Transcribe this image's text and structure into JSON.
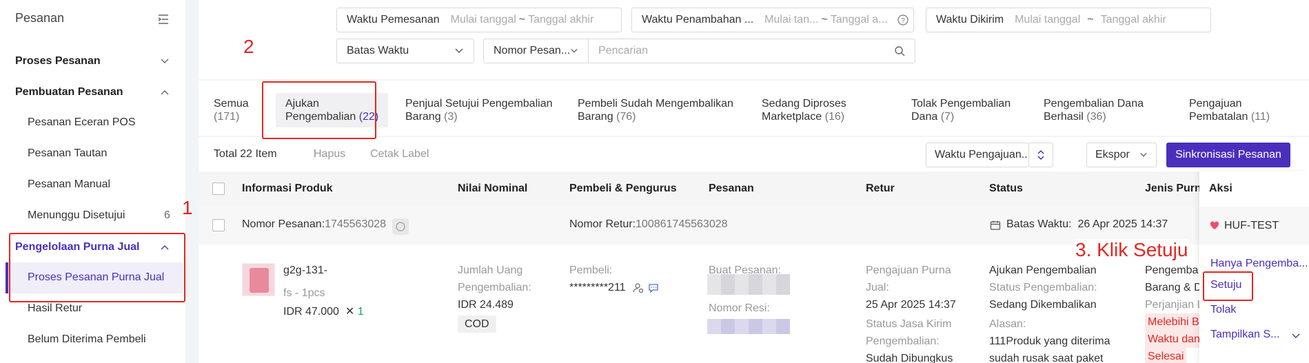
{
  "sidebar": {
    "title": "Pesanan",
    "groups": [
      {
        "label": "Proses Pesanan"
      },
      {
        "label": "Pembuatan Pesanan"
      },
      {
        "label": "Pengelolaan Purna Jual"
      }
    ],
    "items": [
      {
        "label": "Pesanan Eceran POS"
      },
      {
        "label": "Pesanan Tautan"
      },
      {
        "label": "Pesanan Manual"
      },
      {
        "label": "Menunggu Disetujui",
        "count": "6"
      },
      {
        "label": "Proses Pesanan Purna Jual"
      },
      {
        "label": "Hasil Retur"
      },
      {
        "label": "Belum Diterima Pembeli"
      }
    ]
  },
  "annotations": {
    "step1": "1",
    "step2": "2",
    "step3": "3. Klik Setuju"
  },
  "filters": {
    "order_time": {
      "label": "Waktu Pemesanan",
      "start": "Mulai tanggal",
      "sep": "~",
      "end": "Tanggal akhir"
    },
    "added_time": {
      "label": "Waktu Penambahan ...",
      "start": "Mulai tan...",
      "sep": "~",
      "end": "Tanggal a..."
    },
    "sent_time": {
      "label": "Waktu Dikirim",
      "start": "Mulai tanggal",
      "sep": "~",
      "end": "Tanggal akhir"
    },
    "deadline": {
      "label": "Batas Waktu"
    },
    "order_no": {
      "label": "Nomor Pesan..."
    },
    "search": {
      "placeholder": "Pencarian"
    }
  },
  "tabs": [
    {
      "line1": "Semua",
      "count": "(171)"
    },
    {
      "line1": "Ajukan",
      "line2": "Pengembalian",
      "count": "(22)"
    },
    {
      "line1": "Penjual Setujui Pengembalian",
      "line2": "Barang",
      "count": "(3)"
    },
    {
      "line1": "Pembeli Sudah Mengembalikan",
      "line2": "Barang",
      "count": "(76)"
    },
    {
      "line1": "Sedang Diproses",
      "line2": "Marketplace",
      "count": "(16)"
    },
    {
      "line1": "Tolak Pengembalian",
      "line2": "Dana",
      "count": "(7)"
    },
    {
      "line1": "Pengembalian Dana",
      "line2": "Berhasil",
      "count": "(36)"
    },
    {
      "line1": "Pengajuan",
      "line2": "Pembatalan",
      "count": "(11)"
    }
  ],
  "toolbar": {
    "total": "Total 22 Item",
    "delete": "Hapus",
    "print": "Cetak Label",
    "sort_select": "Waktu Pengajuan...",
    "export": "Ekspor",
    "sync": "Sinkronisasi Pesanan"
  },
  "table": {
    "headers": [
      "Informasi Produk",
      "Nilai Nominal",
      "Pembeli & Pengurus",
      "Pesanan",
      "Retur",
      "Status",
      "Jenis Purna",
      "Aksi"
    ]
  },
  "order": {
    "order_no_label": "Nomor Pesanan:",
    "order_no": "1745563028",
    "return_no_label": "Nomor Retur:",
    "return_no": "100861745563028",
    "deadline_label": "Batas Waktu:",
    "deadline": "26 Apr 2025 14:37",
    "store": "HUF-TEST"
  },
  "detail": {
    "product_name": "g2g-131-",
    "variant": "fs - 1pcs",
    "price": "IDR 47.000",
    "qty_x": "✕",
    "qty": "1",
    "refund_label_1": "Jumlah Uang",
    "refund_label_2": "Pengembalian:",
    "refund_value": "IDR 24.489",
    "payment": "COD",
    "buyer_label": "Pembeli:",
    "buyer_value": "*********211",
    "order_made_label": "Buat Pesanan:",
    "receipt_label": "Nomor Resi:",
    "return_apply_label_1": "Pengajuan Purna",
    "return_apply_label_2": "Jual:",
    "return_apply_date": "25 Apr 2025 14:37",
    "courier_label_1": "Status Jasa Kirim",
    "courier_label_2": "Pengembalian:",
    "courier_value": "Sudah Dibungkus",
    "status_1": "Ajukan Pengembalian",
    "status_2": "Status Pengembalian:",
    "status_3": "Sedang Dikembalikan",
    "status_4": "Alasan:",
    "status_5": "111Produk yang diterima",
    "status_6": "sudah rusak saat paket",
    "type_1": "Pengemba",
    "type_2": "Barang & D",
    "type_3": "Perjanjian L",
    "type_4": "Melebihi B",
    "type_5": "Waktu dan",
    "type_6": "Selesai"
  },
  "actions": {
    "only_refund": "Hanya Pengemba...",
    "approve": "Setuju",
    "reject": "Tolak",
    "show_more": "Tampilkan S..."
  },
  "colors": {
    "accent": "#4a2fbd",
    "annotation": "#e5261f"
  }
}
